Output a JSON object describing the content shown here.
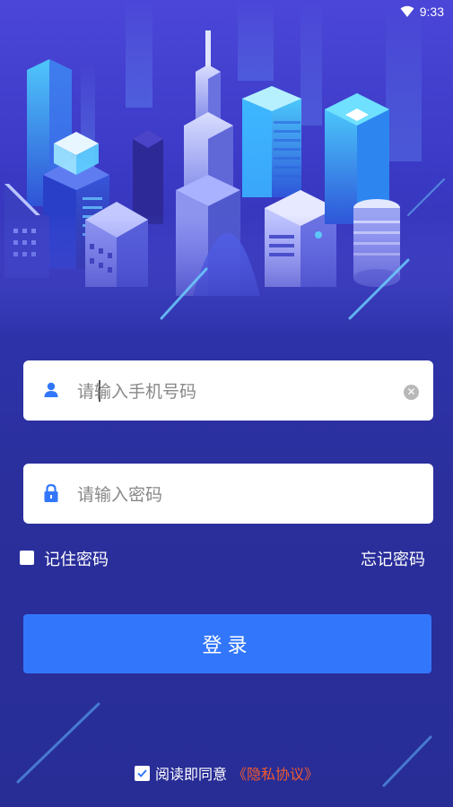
{
  "status_bar": {
    "time": "9:33"
  },
  "login": {
    "phone_placeholder": "请输入手机号码",
    "password_placeholder": "请输入密码",
    "remember_label": "记住密码",
    "forgot_label": "忘记密码",
    "login_button": "登录",
    "agree_text": "阅读即同意",
    "privacy_link": "《隐私协议》"
  },
  "colors": {
    "primary_button": "#3277fb",
    "privacy_link": "#f25a2e",
    "icon_blue": "#3277fb"
  }
}
